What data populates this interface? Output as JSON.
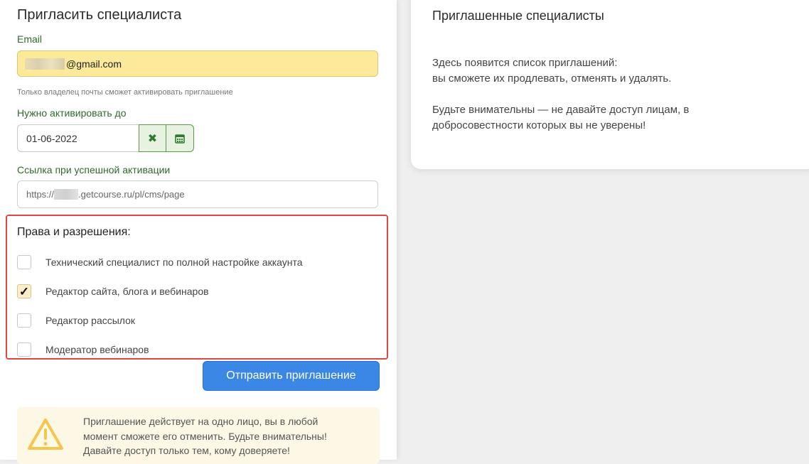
{
  "invite_form": {
    "title": "Пригласить специалиста",
    "email_label": "Email",
    "email_value": "@gmail.com",
    "email_hint": "Только владелец почты сможет активировать приглашение",
    "activate_until_label": "Нужно активировать до",
    "date_value": "01-06-2022",
    "clear_icon": "✖",
    "calendar_icon": "calendar-icon",
    "link_label": "Ссылка при успешной активации",
    "link_value_prefix": "https://",
    "link_value_suffix": ".getcourse.ru/pl/cms/page",
    "permissions_title": "Права и разрешения:",
    "permissions": [
      {
        "label": "Технический специалист по полной настройке аккаунта",
        "checked": false
      },
      {
        "label": "Редактор сайта, блога и вебинаров",
        "checked": true
      },
      {
        "label": "Редактор рассылок",
        "checked": false
      },
      {
        "label": "Модератор вебинаров",
        "checked": false
      }
    ],
    "submit_label": "Отправить приглашение",
    "warning_lines": [
      "Приглашение действует на одно лицо, вы в любой",
      "момент сможете его отменить. Будьте внимательны!",
      "Давайте доступ только тем, кому доверяете!"
    ]
  },
  "invited_panel": {
    "title": "Приглашенные специалисты",
    "paragraph1": [
      "Здесь появится список приглашений:",
      "вы сможете их продлевать, отменять и удалять."
    ],
    "paragraph2": [
      "Будьте внимательны — не давайте доступ лицам, в",
      "добросовестности которых вы не уверены!"
    ]
  },
  "colors": {
    "label_green": "#2e6b2e",
    "email_bg": "#fde99a",
    "highlight_border": "#e04646",
    "primary_button": "#3b87e6",
    "warning_bg": "#fdf7e6",
    "warning_icon": "#f3c74f"
  }
}
